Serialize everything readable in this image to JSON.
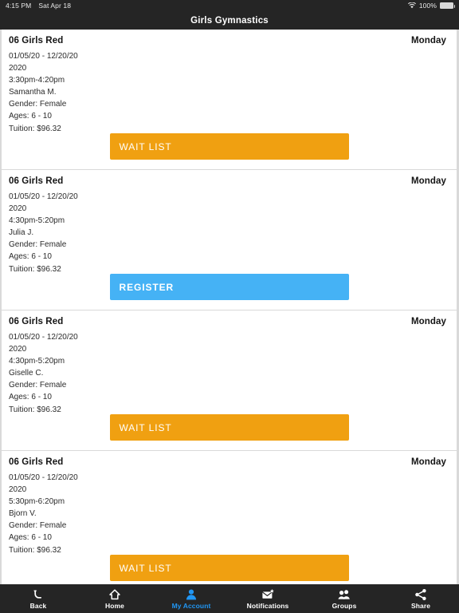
{
  "status_bar": {
    "time": "4:15 PM",
    "date": "Sat Apr 18",
    "battery_percent": "100%",
    "wifi_icon": "wifi-icon",
    "battery_icon": "battery-icon"
  },
  "header": {
    "title": "Girls Gymnastics"
  },
  "colors": {
    "waitlist_button": "#F0A011",
    "register_button": "#45B2F5",
    "bar_background": "#252525",
    "active_tab": "#2196F3",
    "divider": "#d9d9d9"
  },
  "classes": [
    {
      "title": "06 Girls Red",
      "day": "Monday",
      "date_range": "01/05/20 - 12/20/20",
      "year": "2020",
      "time": "3:30pm-4:20pm",
      "instructor": "Samantha M.",
      "gender": "Gender: Female",
      "ages": "Ages: 6 - 10",
      "tuition": "Tuition: $96.32",
      "action_label": "WAIT LIST",
      "action_type": "waitlist"
    },
    {
      "title": "06 Girls Red",
      "day": "Monday",
      "date_range": "01/05/20 - 12/20/20",
      "year": "2020",
      "time": "4:30pm-5:20pm",
      "instructor": "Julia J.",
      "gender": "Gender: Female",
      "ages": "Ages: 6 - 10",
      "tuition": "Tuition: $96.32",
      "action_label": "REGISTER",
      "action_type": "register"
    },
    {
      "title": "06 Girls Red",
      "day": "Monday",
      "date_range": "01/05/20 - 12/20/20",
      "year": "2020",
      "time": "4:30pm-5:20pm",
      "instructor": "Giselle C.",
      "gender": "Gender: Female",
      "ages": "Ages: 6 - 10",
      "tuition": "Tuition: $96.32",
      "action_label": "WAIT LIST",
      "action_type": "waitlist"
    },
    {
      "title": "06 Girls Red",
      "day": "Monday",
      "date_range": "01/05/20 - 12/20/20",
      "year": "2020",
      "time": "5:30pm-6:20pm",
      "instructor": "Bjorn V.",
      "gender": "Gender: Female",
      "ages": "Ages: 6 - 10",
      "tuition": "Tuition: $96.32",
      "action_label": "WAIT LIST",
      "action_type": "waitlist"
    }
  ],
  "tabbar": [
    {
      "label": "Back",
      "icon": "back-arrow-icon",
      "active": false
    },
    {
      "label": "Home",
      "icon": "home-icon",
      "active": false
    },
    {
      "label": "My Account",
      "icon": "person-icon",
      "active": true
    },
    {
      "label": "Notifications",
      "icon": "envelope-star-icon",
      "active": false
    },
    {
      "label": "Groups",
      "icon": "people-group-icon",
      "active": false
    },
    {
      "label": "Share",
      "icon": "share-icon",
      "active": false
    }
  ]
}
